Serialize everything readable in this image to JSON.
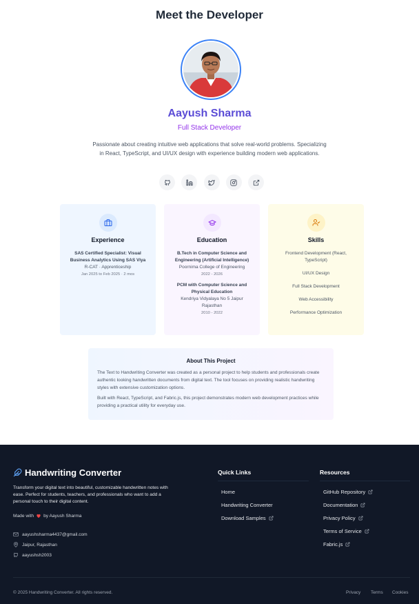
{
  "header": {
    "title": "Meet the Developer"
  },
  "profile": {
    "name": "Aayush Sharma",
    "role": "Full Stack Developer",
    "bio": "Passionate about creating intuitive web applications that solve real-world problems. Specializing in React, TypeScript, and UI/UX design with experience building modern web applications."
  },
  "social": [
    "github-icon",
    "linkedin-icon",
    "twitter-icon",
    "instagram-icon",
    "external-link-icon"
  ],
  "experience": {
    "title": "Experience",
    "role": "SAS Certified Specialist: Visual Business Analytics Using SAS Viya",
    "company": "R-CAT · Apprenticeship",
    "dates": "Jan 2025 to Feb 2025 · 2 mos"
  },
  "education": {
    "title": "Education",
    "items": [
      {
        "degree": "B.Tech in Computer Science and Engineering (Artificial Intelligence)",
        "school": "Poornima College of Engineering",
        "years": "2022 - 2026"
      },
      {
        "degree": "PCM with Computer Science and Physical Education",
        "school": "Kendriya Vidyalaya No 5 Jaipur Rajasthan",
        "years": "2010 - 2022"
      }
    ]
  },
  "skills": {
    "title": "Skills",
    "items": [
      "Frontend Development (React, TypeScript)",
      "UI/UX Design",
      "Full Stack Development",
      "Web Accessibility",
      "Performance Optimization"
    ]
  },
  "about": {
    "title": "About This Project",
    "p1": "The Text to Handwriting Converter was created as a personal project to help students and professionals create authentic looking handwritten documents from digital text. The tool focuses on providing realistic handwriting styles with extensive customization options.",
    "p2": "Built with React, TypeScript, and Fabric.js, this project demonstrates modern web development practices while providing a practical utility for everyday use."
  },
  "footer": {
    "brand": "Handwriting Converter",
    "description": "Transform your digital text into beautiful, customizable handwritten notes with ease. Perfect for students, teachers, and professionals who want to add a personal touch to their digital content.",
    "made_with_prefix": "Made with",
    "made_with_suffix": "by Aayush Sharma",
    "email": "aayushsharma4437@gmail.com",
    "location": "Jaipur, Rajasthan",
    "github": "aayushsh2003",
    "quick_links_title": "Quick Links",
    "quick_links": [
      "Home",
      "Handwriting Converter",
      "Download Samples"
    ],
    "resources_title": "Resources",
    "resources": [
      "GitHub Repository",
      "Documentation",
      "Privacy Policy",
      "Terms of Service",
      "Fabric.js"
    ],
    "copyright": "© 2025 Handwriting Converter. All rights reserved.",
    "legal": [
      "Privacy",
      "Terms",
      "Cookies"
    ]
  },
  "colors": {
    "accent_blue": "#3b82f6",
    "accent_purple": "#9333ea",
    "footer_bg": "#111827",
    "experience_bg": "#eff6ff",
    "education_bg": "#faf5ff",
    "skills_bg": "#fefce8"
  }
}
